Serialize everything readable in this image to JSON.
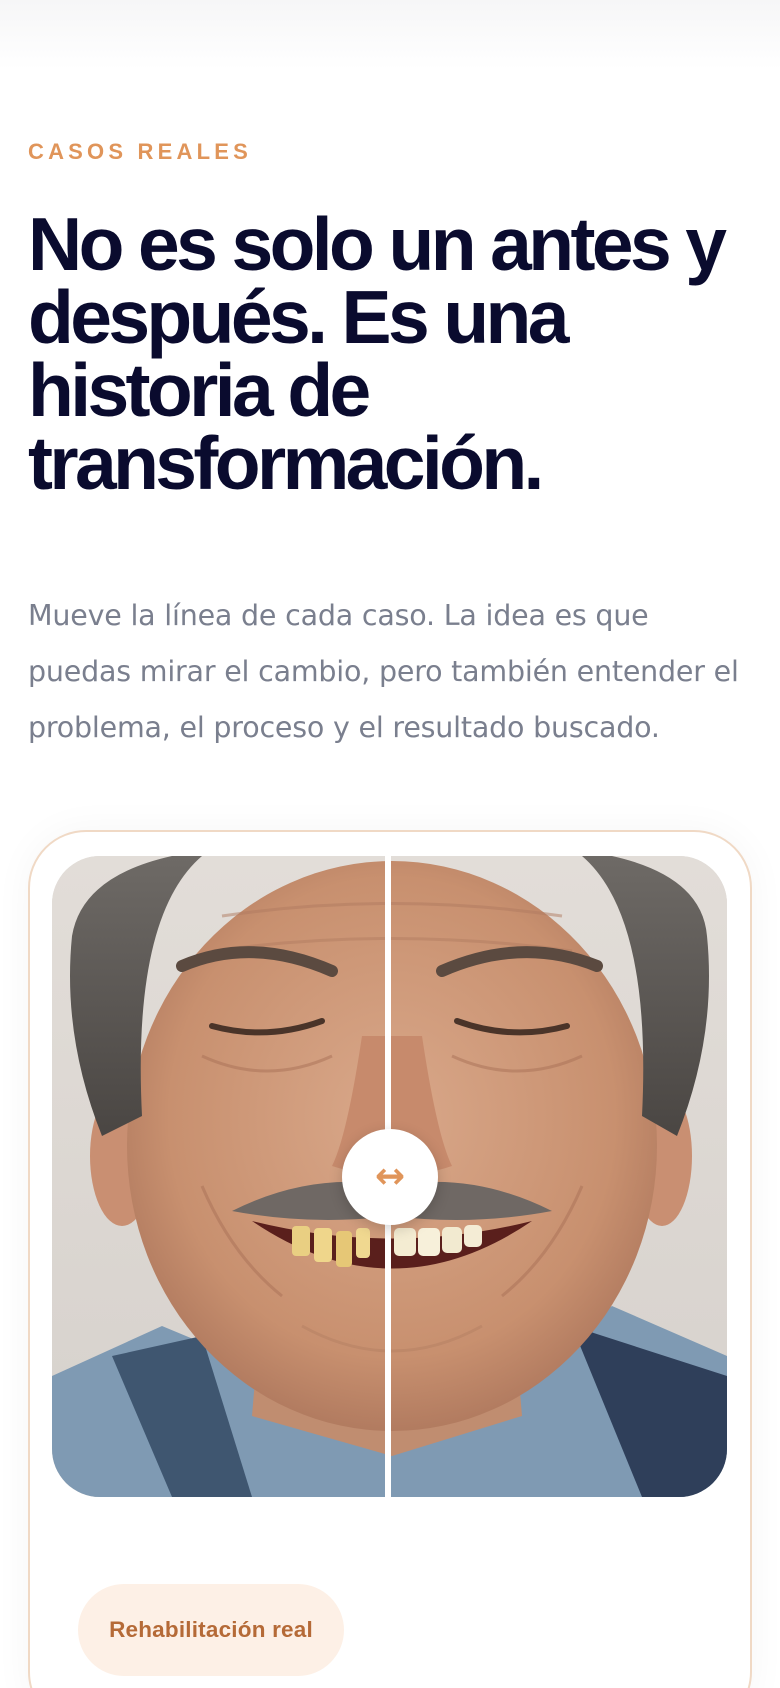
{
  "section": {
    "eyebrow": "CASOS REALES",
    "headline": "No es solo un antes y después. Es una historia de transformación.",
    "intro": "Mueve la línea de cada caso. La idea es que puedas mirar el cambio, pero también entender el problema, el proceso y el resultado buscado."
  },
  "case": {
    "slider_position_percent": 50,
    "handle_icon": "left-right-arrow-icon",
    "handle_glyph": "↔",
    "badge_label": "Rehabilitación real"
  },
  "colors": {
    "accent": "#e0955a",
    "heading": "#0a0b2e",
    "body_text": "#7a7f8e",
    "badge_bg": "#fdf0e6",
    "badge_text": "#b56a37",
    "card_border": "#f0d9c5"
  }
}
